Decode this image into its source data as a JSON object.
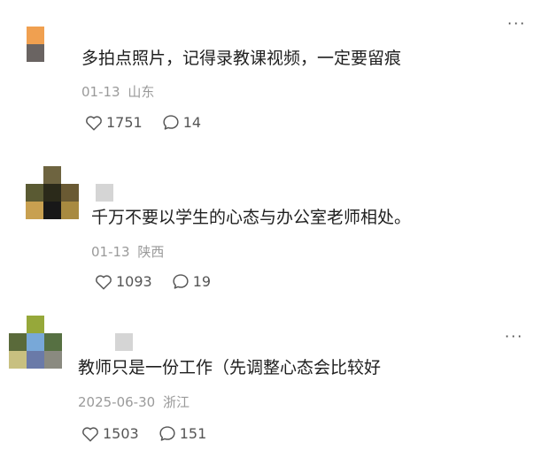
{
  "comments": [
    {
      "text": "多拍点照片，记得录教课视频，一定要留痕",
      "date": "01-13",
      "location": "山东",
      "likes": "1751",
      "replies": "14",
      "more": "···",
      "avatar_colors": [
        "#f0a050",
        "#6a6462"
      ]
    },
    {
      "text": "千万不要以学生的心态与办公室老师相处。",
      "date": "01-13",
      "location": "陕西",
      "likes": "1093",
      "replies": "19",
      "avatar_colors": [
        "#ffffff",
        "#6e6440",
        "#ffffff",
        "#5a5a33",
        "#2b2a1a",
        "#6a5a33",
        "#c8a050",
        "#181818",
        "#a88a40"
      ]
    },
    {
      "text": "教师只是一份工作（先调整心态会比较好",
      "date": "2025-06-30",
      "location": "浙江",
      "likes": "1503",
      "replies": "151",
      "more": "···",
      "avatar_colors": [
        "#ffffff",
        "#96a83a",
        "#ffffff",
        "#5a6a3a",
        "#78a8d8",
        "#567042",
        "#c8c080",
        "#6a7aa8",
        "#8a8a80"
      ]
    }
  ],
  "icons": {
    "like": "heart-outline-icon",
    "reply": "speech-bubble-icon",
    "more": "more-dots-icon"
  }
}
